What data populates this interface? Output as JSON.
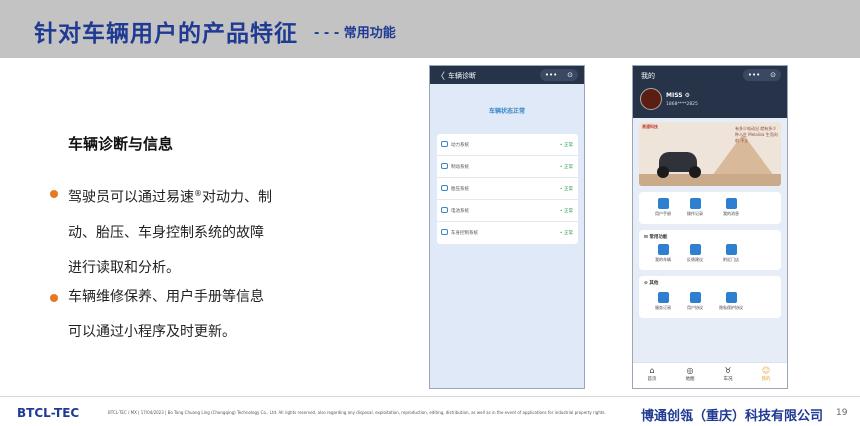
{
  "header": {
    "title": "针对车辆用户的产品特征",
    "subtitle": "- - - 常用功能"
  },
  "content": {
    "heading": "车辆诊断与信息",
    "bullet1": {
      "line1_pre": "驾驶员可以通过易速",
      "line1_sup": "®",
      "line1_post": "对动力、制",
      "line2": "动、胎压、车身控制系统的故障",
      "line3": "进行读取和分析。"
    },
    "bullet2": {
      "line1": "车辆维修保养、用户手册等信息",
      "line2": "可以通过小程序及时更新。"
    },
    "bullet_color": "#e87722"
  },
  "phone_diag": {
    "back": "〈",
    "title": "车辆诊断",
    "capsule_dots": "•••",
    "capsule_close": "⊙",
    "status": "车辆状态正常",
    "rows": [
      {
        "label": "动力系统",
        "status": "• 正常"
      },
      {
        "label": "制动系统",
        "status": "• 正常"
      },
      {
        "label": "胎压系统",
        "status": "• 正常"
      },
      {
        "label": "电池系统",
        "status": "• 正常"
      },
      {
        "label": "车身控制系统",
        "status": "• 正常"
      }
    ]
  },
  "phone_me": {
    "title": "我的",
    "capsule_dots": "•••",
    "capsule_close": "⊙",
    "user_name": "MISS ⚙",
    "user_phone": "1868****2825",
    "banner": {
      "logo": "易速科技",
      "text": "有多少电动出 就有多少种人生 Melalisa 生而向前 不止"
    },
    "quick": [
      {
        "label": "用户手册"
      },
      {
        "label": "操作记录"
      },
      {
        "label": "我的消息"
      }
    ],
    "common_header": "⊞ 常用功能",
    "common": [
      {
        "label": "我的车辆"
      },
      {
        "label": "反馈建议"
      },
      {
        "label": "附近门店"
      }
    ],
    "other_header": "⊙ 其他",
    "other": [
      {
        "label": "服务订阅"
      },
      {
        "label": "用户协议"
      },
      {
        "label": "隐私保护协议"
      }
    ],
    "tabs": [
      {
        "icon": "⌂",
        "label": "首页"
      },
      {
        "icon": "◎",
        "label": "地图"
      },
      {
        "icon": "♉",
        "label": "车况"
      },
      {
        "icon": "☺",
        "label": "我的"
      }
    ]
  },
  "footer": {
    "brand": "BTCL-TEC",
    "copyright": "BTCL-TEC / MX | 17/04/2023 | Bo Tong Chuang Ling (Chongqing) Technology Co., Ltd.  All rights reserved, also regarding any disposal, exploitation, reproduction, editing, distribution, as well as in the event of applications for industrial property rights.",
    "company": "博通创瓴（重庆）科技有限公司",
    "page": "19"
  }
}
